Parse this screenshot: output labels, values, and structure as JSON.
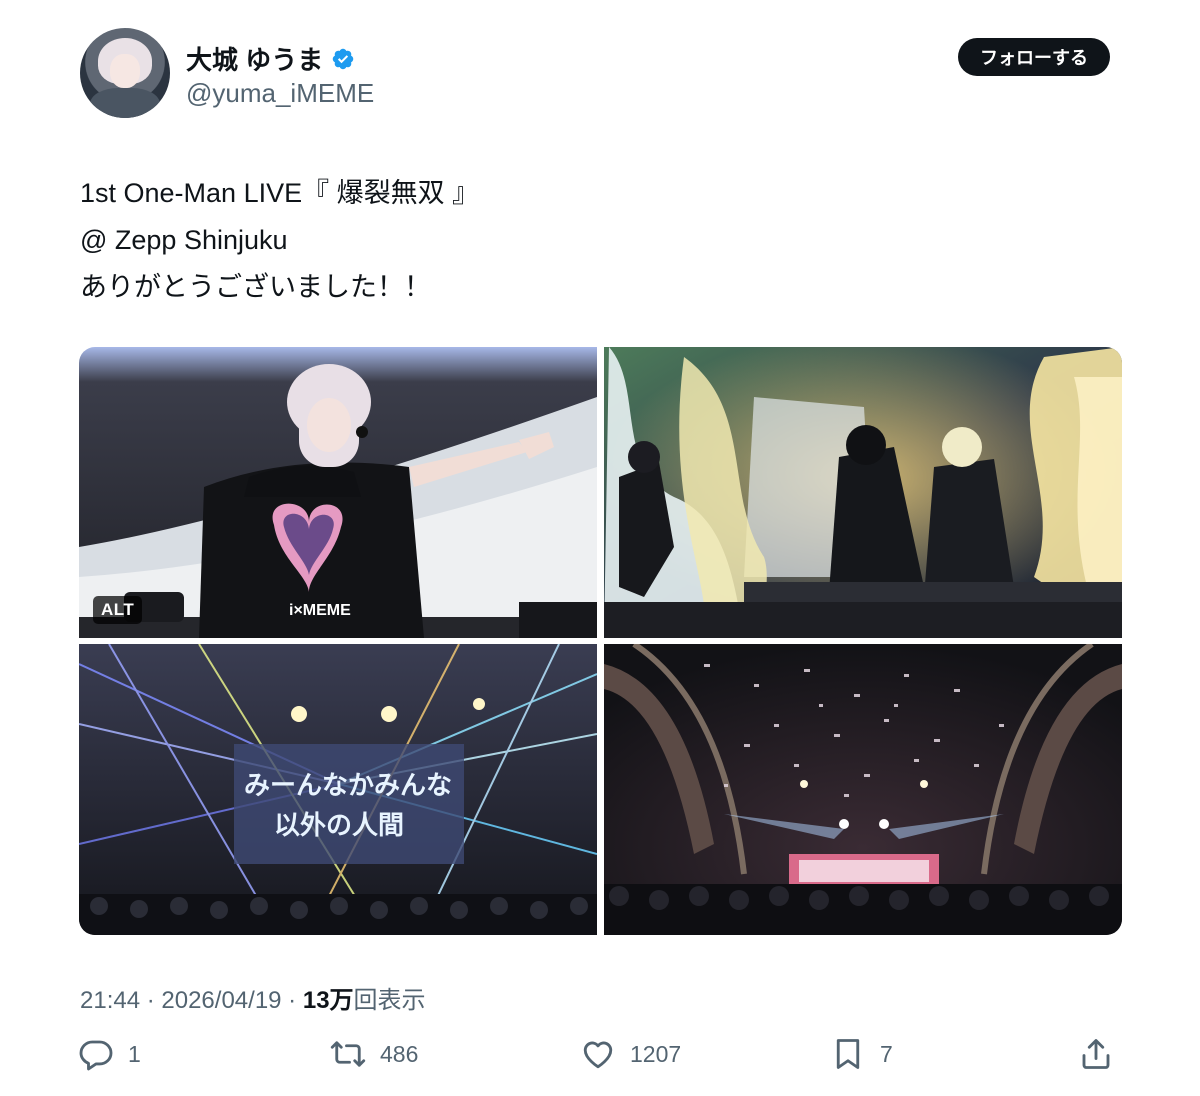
{
  "author": {
    "display_name": "大城 ゆうま",
    "handle": "@yuma_iMEME",
    "verified": true
  },
  "follow_button": "フォローする",
  "tweet": {
    "lines": [
      "1st One-Man LIVE『 爆裂無双 』",
      "@ Zepp Shinjuku",
      "ありがとうございました！！"
    ]
  },
  "media": {
    "alt_badge": "ALT",
    "photos": [
      "live-photo-singer",
      "live-photo-stage-smoke",
      "live-photo-lasers",
      "live-photo-confetti"
    ],
    "stage_screen_text": [
      "みーんなかみんな",
      "以外の人間"
    ],
    "shirt_text": "i×MEME"
  },
  "meta": {
    "time": "21:44",
    "date": "2026/04/19",
    "sep": " · ",
    "views_count": "13万",
    "views_label": "回表示"
  },
  "actions": {
    "reply": "1",
    "retweet": "486",
    "like": "1207",
    "bookmark": "7"
  },
  "colors": {
    "text": "#0f1419",
    "secondary": "#536471",
    "verified": "#1d9bf0",
    "follow_bg": "#0f1419"
  },
  "icons": [
    "verified-badge-icon",
    "reply-icon",
    "retweet-icon",
    "like-icon",
    "bookmark-icon",
    "share-icon"
  ]
}
